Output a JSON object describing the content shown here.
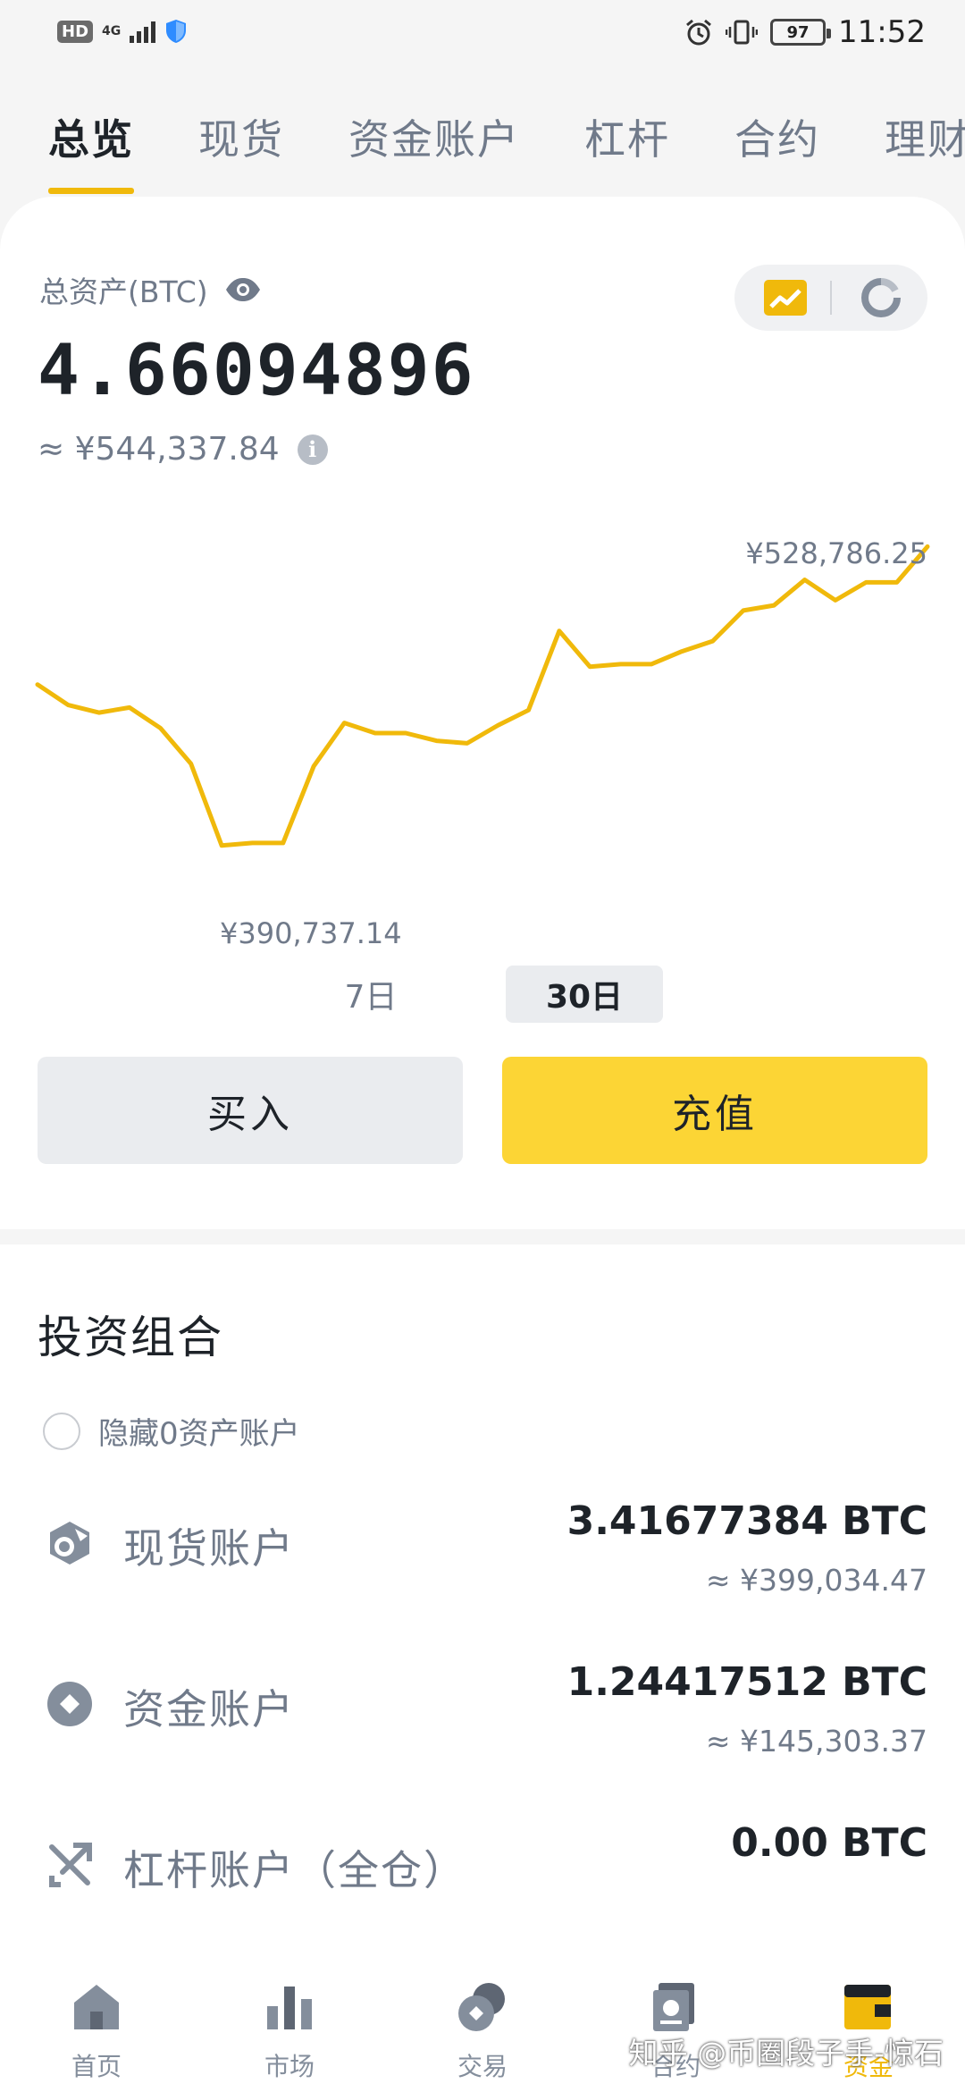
{
  "status_bar": {
    "hd": "HD",
    "network": "4G",
    "battery": "97",
    "time": "11:52"
  },
  "tabs": [
    {
      "label": "总览",
      "active": true
    },
    {
      "label": "现货",
      "active": false
    },
    {
      "label": "资金账户",
      "active": false
    },
    {
      "label": "杠杆",
      "active": false
    },
    {
      "label": "合约",
      "active": false
    },
    {
      "label": "理财",
      "active": false
    }
  ],
  "summary": {
    "total_label": "总资产(BTC)",
    "total_btc": "4.66094896",
    "total_cny": "≈ ¥544,337.84"
  },
  "chart_data": {
    "type": "line",
    "series": [
      {
        "values": [
          455,
          447,
          444,
          446,
          438,
          424,
          392,
          393,
          393,
          423,
          440,
          436,
          436,
          433,
          432,
          439,
          445,
          476,
          462,
          463,
          463,
          468,
          472,
          484,
          486,
          496,
          488,
          495,
          495,
          509
        ]
      }
    ],
    "max_label": "¥528,786.25",
    "min_label": "¥390,737.14",
    "ylim": [
      380,
      520
    ],
    "line_color": "#f0b90b",
    "periods": [
      "7日",
      "30日"
    ],
    "selected_period": "30日"
  },
  "actions": {
    "buy": "买入",
    "deposit": "充值"
  },
  "portfolio": {
    "title": "投资组合",
    "hide_zero": "隐藏0资产账户",
    "accounts": [
      {
        "name": "现货账户",
        "btc": "3.41677384 BTC",
        "cny": "≈ ¥399,034.47",
        "icon": "spot-account-icon"
      },
      {
        "name": "资金账户",
        "btc": "1.24417512 BTC",
        "cny": "≈ ¥145,303.37",
        "icon": "funding-account-icon"
      },
      {
        "name": "杠杆账户（全仓）",
        "btc": "0.00 BTC",
        "cny": "",
        "icon": "margin-account-icon"
      }
    ]
  },
  "bottom_nav": [
    {
      "label": "首页",
      "icon": "home-icon",
      "active": false
    },
    {
      "label": "市场",
      "icon": "market-icon",
      "active": false
    },
    {
      "label": "交易",
      "icon": "trade-icon",
      "active": false
    },
    {
      "label": "合约",
      "icon": "futures-icon",
      "active": false
    },
    {
      "label": "资金",
      "icon": "wallet-icon",
      "active": true
    }
  ],
  "watermark": "知乎 @币圈段子手-惊石",
  "colors": {
    "accent": "#f0b90b",
    "button_yellow": "#fcd535",
    "text_primary": "#1e2329",
    "text_secondary": "#707a8a"
  }
}
